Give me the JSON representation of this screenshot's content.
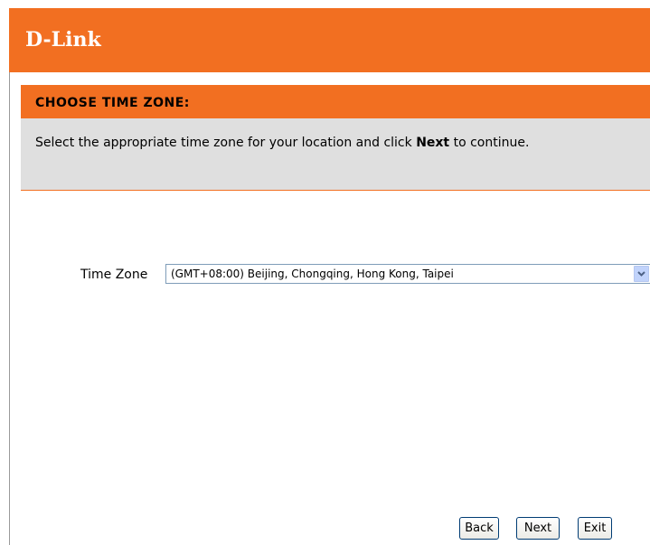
{
  "header": {
    "logo_text": "D-Link"
  },
  "section": {
    "title": "CHOOSE TIME ZONE:",
    "description_prefix": "Select the appropriate time zone for your location and click ",
    "description_bold": "Next",
    "description_suffix": " to continue."
  },
  "form": {
    "timezone_label": "Time Zone",
    "timezone_selected": "(GMT+08:00) Beijing, Chongqing, Hong Kong, Taipei"
  },
  "buttons": {
    "back": "Back",
    "next": "Next",
    "exit": "Exit"
  },
  "colors": {
    "accent": "#f26f21",
    "panel_bg": "#dfdfdf"
  },
  "icons": {
    "dropdown": "chevron-down-icon"
  }
}
